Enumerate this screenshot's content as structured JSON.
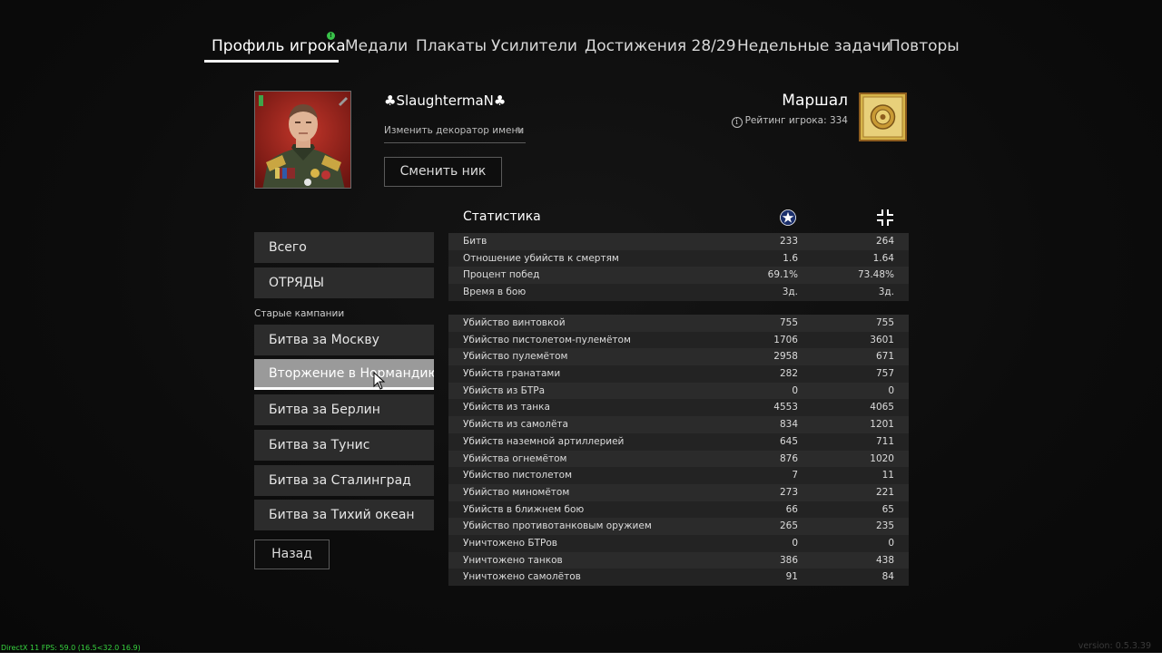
{
  "nav": {
    "tabs": [
      {
        "label": "Профиль игрока",
        "active": true,
        "notification": "!"
      },
      {
        "label": "Медали"
      },
      {
        "label": "Плакаты"
      },
      {
        "label": "Усилители"
      },
      {
        "label": "Достижения 28/29"
      },
      {
        "label": "Недельные задачи"
      },
      {
        "label": "Повторы"
      }
    ]
  },
  "profile": {
    "player_name": "♣SlaughtermaN♣",
    "decorator_link": "Изменить декоратор имени",
    "change_nick_button": "Сменить ник",
    "rank_title": "Маршал",
    "rating": "Рейтинг игрока: 334"
  },
  "menu": {
    "total": "Всего",
    "squads": "ОТРЯДЫ",
    "old_campaigns_label": "Старые кампании",
    "campaigns": [
      {
        "label": "Битва за Москву"
      },
      {
        "label": "Вторжение в Нормандию",
        "selected": true
      },
      {
        "label": "Битва за Берлин"
      },
      {
        "label": "Битва за Тунис"
      },
      {
        "label": "Битва за Сталинград"
      },
      {
        "label": "Битва за Тихий океан"
      }
    ],
    "back_button": "Назад"
  },
  "stats": {
    "title": "Статистика",
    "column_icons": [
      "allied-star-icon",
      "axis-cross-icon"
    ],
    "summary": [
      {
        "label": "Битв",
        "allies": "233",
        "axis": "264"
      },
      {
        "label": "Отношение убийств к смертям",
        "allies": "1.6",
        "axis": "1.64"
      },
      {
        "label": "Процент побед",
        "allies": "69.1%",
        "axis": "73.48%"
      },
      {
        "label": "Время в бою",
        "allies": "3д.",
        "axis": "3д."
      }
    ],
    "details": [
      {
        "label": "Убийство винтовкой",
        "allies": "755",
        "axis": "755"
      },
      {
        "label": "Убийство пистолетом-пулемётом",
        "allies": "1706",
        "axis": "3601"
      },
      {
        "label": "Убийство пулемётом",
        "allies": "2958",
        "axis": "671"
      },
      {
        "label": "Убийств гранатами",
        "allies": "282",
        "axis": "757"
      },
      {
        "label": "Убийств из БТРа",
        "allies": "0",
        "axis": "0"
      },
      {
        "label": "Убийств из танка",
        "allies": "4553",
        "axis": "4065"
      },
      {
        "label": "Убийств из самолёта",
        "allies": "834",
        "axis": "1201"
      },
      {
        "label": "Убийств наземной артиллерией",
        "allies": "645",
        "axis": "711"
      },
      {
        "label": "Убийства огнемётом",
        "allies": "876",
        "axis": "1020"
      },
      {
        "label": "Убийство пистолетом",
        "allies": "7",
        "axis": "11"
      },
      {
        "label": "Убийство миномётом",
        "allies": "273",
        "axis": "221"
      },
      {
        "label": "Убийств в ближнем бою",
        "allies": "66",
        "axis": "65"
      },
      {
        "label": "Убийство противотанковым оружием",
        "allies": "265",
        "axis": "235"
      },
      {
        "label": "Уничтожено БТРов",
        "allies": "0",
        "axis": "0"
      },
      {
        "label": "Уничтожено танков",
        "allies": "386",
        "axis": "438"
      },
      {
        "label": "Уничтожено самолётов",
        "allies": "91",
        "axis": "84"
      }
    ]
  },
  "footer": {
    "fps": "DirectX 11 FPS: 59.0 (16.5<32.0 16.9)",
    "version": "version: 0.5.3.39"
  },
  "colors": {
    "background": "#0c0c0c",
    "selected_menu": "#9a9a9a",
    "row_odd": "#2b2b2b",
    "row_even": "#232323",
    "notification": "#39c24a",
    "fps_text": "#37d23f",
    "allied_star": "#1b2f6b",
    "rank_gold": "#d6b44a"
  }
}
